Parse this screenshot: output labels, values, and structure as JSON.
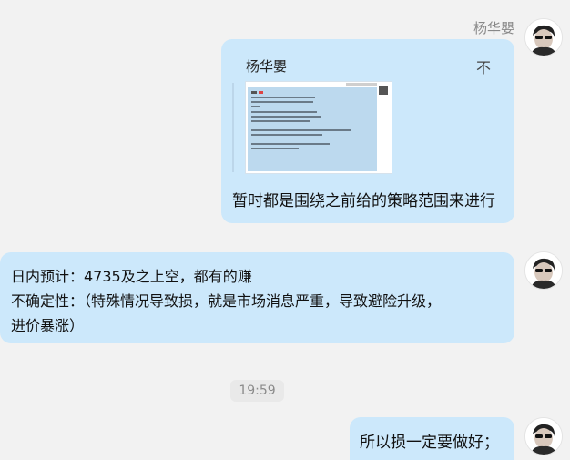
{
  "messages": [
    {
      "sender": "杨华嬰",
      "quote": {
        "author": "杨华嬰",
        "close_icon": "不"
      },
      "text": "暂时都是围绕之前给的策略范围来进行"
    },
    {
      "lines": [
        "日内预计：4735及之上空，都有的赚",
        "不确定性：（特殊情况导致损，就是市场消息严重，导致避险升级，",
        "进价暴涨）"
      ]
    },
    {
      "text": "所以损一定要做好；"
    }
  ],
  "timestamp": "19:59"
}
